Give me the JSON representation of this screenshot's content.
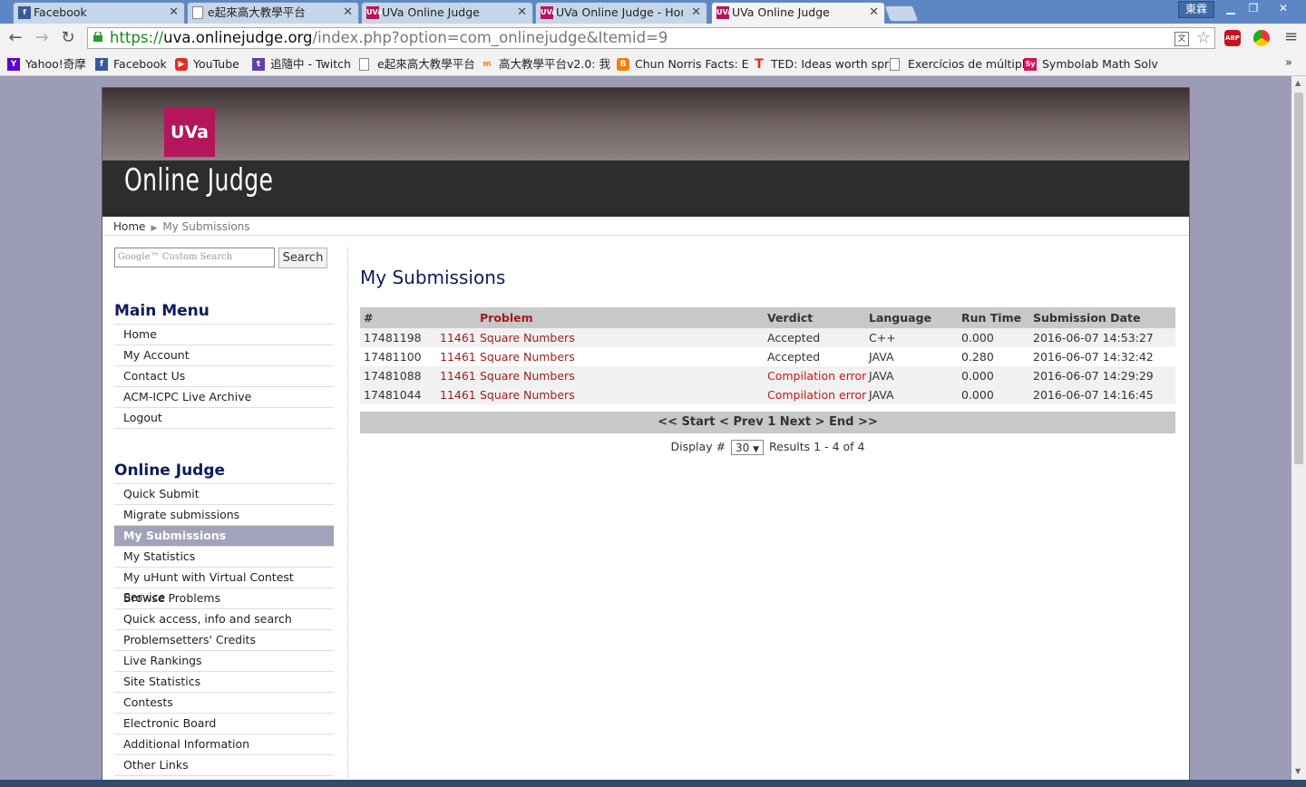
{
  "browser": {
    "tabs": [
      {
        "title": "Facebook",
        "icon": "facebook-icon",
        "active": false
      },
      {
        "title": "e起來高大教學平台",
        "icon": "page-icon",
        "active": false
      },
      {
        "title": "UVa Online Judge",
        "icon": "uva-icon",
        "active": false
      },
      {
        "title": "UVa Online Judge - Hom",
        "icon": "uva-icon",
        "active": false
      },
      {
        "title": "UVa Online Judge",
        "icon": "uva-icon",
        "active": true
      }
    ],
    "user_name": "東霖",
    "url": {
      "scheme": "https://",
      "host": "uva.onlinejudge.org",
      "path": "/index.php?option=com_onlinejudge&Itemid=9"
    },
    "bookmarks": [
      {
        "label": "Yahoo!奇摩",
        "icon": "yahoo-icon",
        "color": "#5f01d1"
      },
      {
        "label": "Facebook",
        "icon": "facebook-icon",
        "color": "#3b5998"
      },
      {
        "label": "YouTube",
        "icon": "youtube-icon",
        "color": "#e52d27"
      },
      {
        "label": "追隨中 - Twitch",
        "icon": "twitch-icon",
        "color": "#6441a5"
      },
      {
        "label": "e起來高大教學平台",
        "icon": "page-icon",
        "color": ""
      },
      {
        "label": "高大教學平台v2.0: 我",
        "icon": "moodle-icon",
        "color": "#f98012"
      },
      {
        "label": "Chun Norris Facts: E",
        "icon": "blogger-icon",
        "color": "#f57d00"
      },
      {
        "label": "TED: Ideas worth spr",
        "icon": "ted-icon",
        "color": "#e62b1e"
      },
      {
        "label": "Exercícios de múltipl",
        "icon": "page-icon",
        "color": ""
      },
      {
        "label": "Symbolab Math Solv",
        "icon": "symbolab-icon",
        "color": "#d2145a"
      }
    ]
  },
  "site": {
    "logo_text": "UVa",
    "name": "Online Judge",
    "brand_color": "#b5155a"
  },
  "breadcrumb": {
    "home": "Home",
    "current": "My Submissions"
  },
  "search": {
    "placeholder": "Google™ Custom Search",
    "button": "Search"
  },
  "main_menu": {
    "title": "Main Menu",
    "items": [
      "Home",
      "My Account",
      "Contact Us",
      "ACM-ICPC Live Archive",
      "Logout"
    ]
  },
  "judge_menu": {
    "title": "Online Judge",
    "items": [
      "Quick Submit",
      "Migrate submissions",
      "My Submissions",
      "My Statistics",
      "My uHunt with Virtual Contest Service",
      "Browse Problems",
      "Quick access, info and search",
      "Problemsetters' Credits",
      "Live Rankings",
      "Site Statistics",
      "Contests",
      "Electronic Board",
      "Additional Information",
      "Other Links"
    ],
    "active_index": 2
  },
  "content": {
    "title": "My Submissions",
    "columns": [
      "#",
      "Problem",
      "Verdict",
      "Language",
      "Run Time",
      "Submission Date"
    ],
    "rows": [
      {
        "id": "17481198",
        "problem_id": "11461",
        "problem": "Square Numbers",
        "verdict": "Accepted",
        "language": "C++",
        "runtime": "0.000",
        "date": "2016-06-07 14:53:27"
      },
      {
        "id": "17481100",
        "problem_id": "11461",
        "problem": "Square Numbers",
        "verdict": "Accepted",
        "language": "JAVA",
        "runtime": "0.280",
        "date": "2016-06-07 14:32:42"
      },
      {
        "id": "17481088",
        "problem_id": "11461",
        "problem": "Square Numbers",
        "verdict": "Compilation error",
        "language": "JAVA",
        "runtime": "0.000",
        "date": "2016-06-07 14:29:29"
      },
      {
        "id": "17481044",
        "problem_id": "11461",
        "problem": "Square Numbers",
        "verdict": "Compilation error",
        "language": "JAVA",
        "runtime": "0.000",
        "date": "2016-06-07 14:16:45"
      }
    ],
    "pager": "<< Start < Prev 1 Next > End >>",
    "display_label": "Display #",
    "display_value": "30",
    "results": "Results 1 - 4 of 4"
  }
}
